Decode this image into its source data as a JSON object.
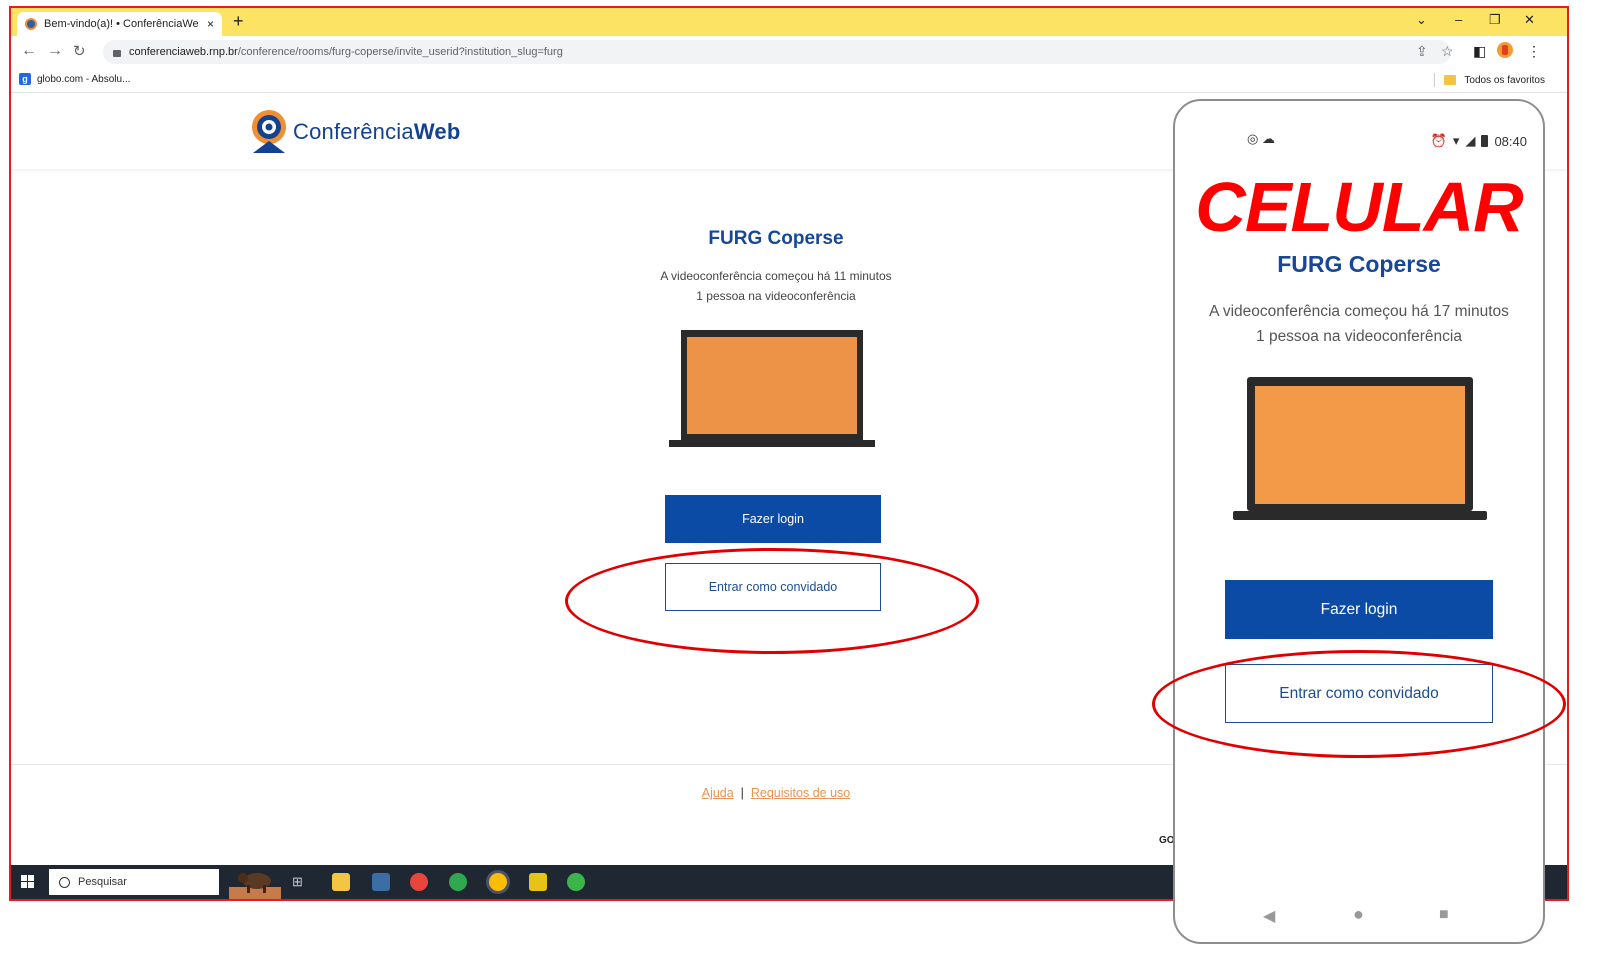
{
  "browser": {
    "tab_title": "Bem-vindo(a)! • ConferênciaWe",
    "tab_close": "×",
    "new_tab": "+",
    "window_controls": [
      "⌄",
      "–",
      "❐",
      "✕"
    ],
    "url_host": "conferenciaweb.rnp.br",
    "url_path": "/conference/rooms/furg-coperse/invite_userid?institution_slug=furg",
    "bookmark_left": "globo.com - Absolu...",
    "bookmark_right": "Todos os favoritos"
  },
  "site": {
    "logo_text_regular": "Conferência",
    "logo_text_bold": "Web",
    "room_title": "FURG Coperse",
    "started_text": "A videoconferência começou há 11 minutos",
    "people_text": "1 pessoa na videoconferência",
    "login_label": "Fazer login",
    "guest_label": "Entrar como convidado",
    "footer_help": "Ajuda",
    "footer_sep": "|",
    "footer_terms": "Requisitos de uso",
    "fragment_text": "GO"
  },
  "taskbar": {
    "search_placeholder": "Pesquisar"
  },
  "phone": {
    "clock": "08:40",
    "annotation_label": "CELULAR",
    "room_title": "FURG Coperse",
    "started_text": "A videoconferência começou há 17 minutos",
    "people_text": "1 pessoa na videoconferência",
    "login_label": "Fazer login",
    "guest_label": "Entrar como convidado"
  },
  "colors": {
    "annotation_red": "#e00000",
    "brand_blue": "#0b4ba6",
    "laptop_screen": "#f39a49",
    "tab_bar_yellow": "#fde363"
  }
}
